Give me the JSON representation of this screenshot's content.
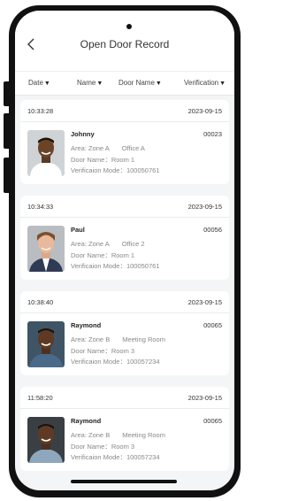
{
  "header": {
    "title": "Open Door Record"
  },
  "filters": [
    "Date",
    "Name",
    "Door Name",
    "Verification"
  ],
  "records": [
    {
      "time": "10:33:28",
      "date": "2023-09-15",
      "name": "Johnny",
      "code": "00023",
      "area": "Area: Zone A",
      "office": "Office A",
      "door": "Door Name：Room 1",
      "mode": "Verificaion Mode：100050761"
    },
    {
      "time": "10:34:33",
      "date": "2023-09-15",
      "name": "Paul",
      "code": "00056",
      "area": "Area: Zone A",
      "office": "Office 2",
      "door": "Door Name：Room 1",
      "mode": "Verificaion Mode：100050761"
    },
    {
      "time": "10:38:40",
      "date": "2023-09-15",
      "name": "Raymond",
      "code": "00065",
      "area": "Area: Zone B",
      "office": "Meeting Room",
      "door": "Door Name：Room 3",
      "mode": "Verificaion Mode：100057234"
    },
    {
      "time": "11:58:20",
      "date": "2023-09-15",
      "name": "Raymond",
      "code": "00065",
      "area": "Area: Zone B",
      "office": "Meeting Room",
      "door": "Door Name：Room 3",
      "mode": "Verificaion Mode：100057234"
    }
  ],
  "icons": {
    "back": "chevron-left-icon",
    "sort": "triangle-down-icon"
  }
}
